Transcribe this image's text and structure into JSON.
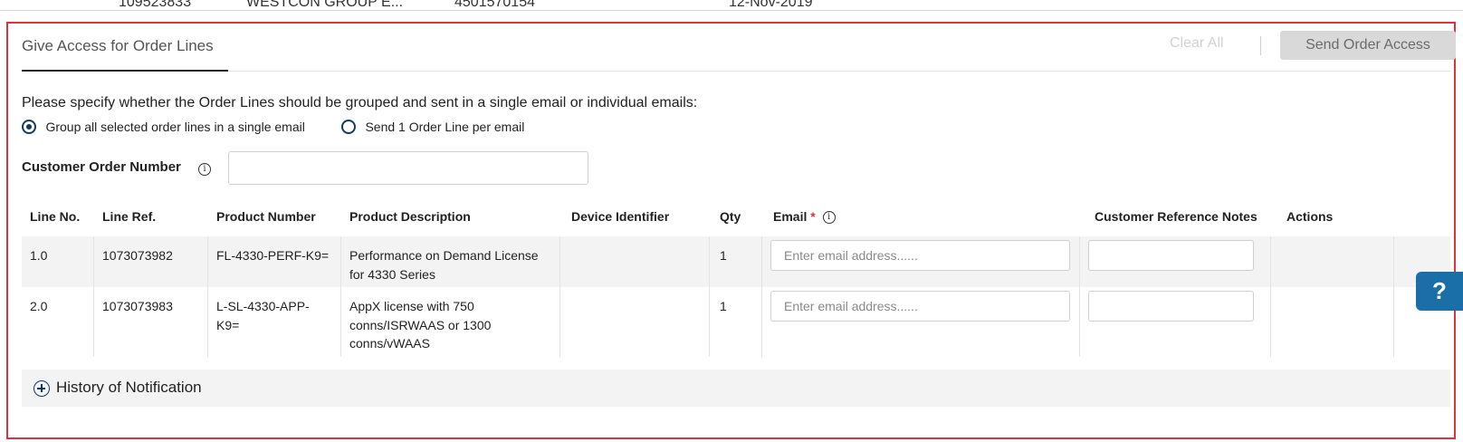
{
  "top_row": {
    "id": "109523833",
    "partner": "WESTCON GROUP E...",
    "po": "4501570154",
    "date": "12-Nov-2019"
  },
  "section": {
    "tab_label": "Give Access for Order Lines",
    "clear_all_label": "Clear All",
    "send_button_label": "Send Order Access",
    "instruction": "Please specify whether the Order Lines should be grouped and sent in a single email or individual emails:",
    "radio_options": [
      {
        "label": "Group all selected order lines in a single email",
        "selected": true
      },
      {
        "label": "Send 1 Order Line per email",
        "selected": false
      }
    ],
    "customer_order_number_label": "Customer Order Number",
    "customer_order_number_value": ""
  },
  "table": {
    "columns": [
      "Line No.",
      "Line Ref.",
      "Product Number",
      "Product Description",
      "Device Identifier",
      "Qty",
      "Email",
      "Customer Reference Notes",
      "Actions"
    ],
    "email_required_mark": "*",
    "email_placeholder": "Enter email address......",
    "rows": [
      {
        "line_no": "1.0",
        "line_ref": "1073073982",
        "product_number": "FL-4330-PERF-K9=",
        "product_description": "Performance on Demand License for 4330 Series",
        "device_identifier": "",
        "qty": "1",
        "email": "",
        "notes": ""
      },
      {
        "line_no": "2.0",
        "line_ref": "1073073983",
        "product_number": "L-SL-4330-APP-K9=",
        "product_description": "AppX license with 750 conns/ISRWAAS or 1300 conns/vWAAS",
        "device_identifier": "",
        "qty": "1",
        "email": "",
        "notes": ""
      }
    ]
  },
  "history_label": "History of Notification",
  "help_label": "?",
  "colors": {
    "highlight_border": "#e0323a",
    "primary": "#0d3b66",
    "help_button": "#1b6fa8",
    "disabled_button": "#d9d9d9"
  }
}
